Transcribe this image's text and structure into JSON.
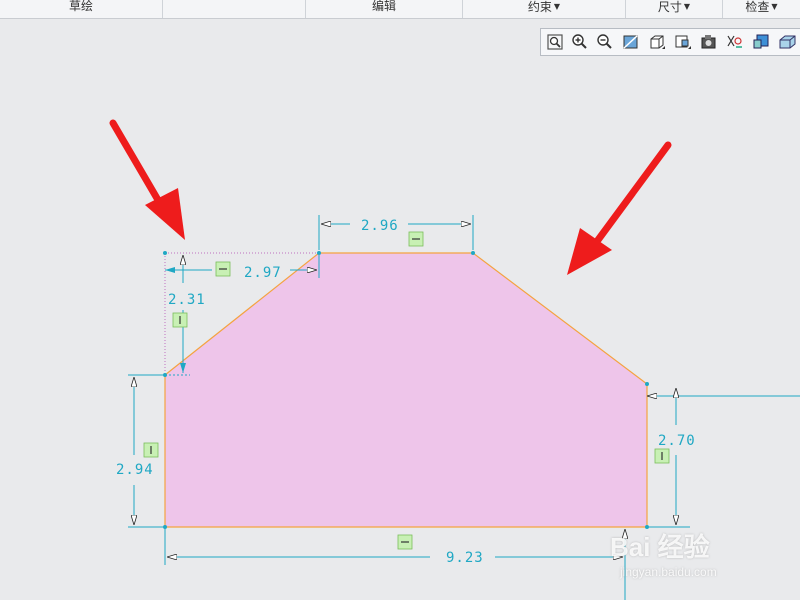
{
  "ribbon": {
    "groups": [
      {
        "label": "草绘",
        "dropdown": false
      },
      {
        "label": "编辑",
        "dropdown": false
      },
      {
        "label": "约束",
        "dropdown": true
      },
      {
        "label": "尺寸",
        "dropdown": true
      },
      {
        "label": "检查",
        "dropdown": true
      }
    ]
  },
  "view_toolbar": {
    "buttons": [
      "refit-icon",
      "zoom-in-icon",
      "zoom-out-icon",
      "repaint-icon",
      "display-style-icon",
      "saved-orientations-icon",
      "view-manager-icon",
      "sketch-display-filters-icon",
      "sketch-view-icon",
      "section-view-icon"
    ]
  },
  "sketch": {
    "fill_color": "#eec5ea",
    "edge_color": "#f4a340",
    "dimension_color": "#20a8c4",
    "dimensions": {
      "top": "2.96",
      "chamfer_left_horizontal": "2.97",
      "chamfer_left_vertical": "2.31",
      "left_height": "2.94",
      "right_height": "2.70",
      "bottom_width": "9.23"
    }
  },
  "annotations": {
    "arrow_color": "#ee1c1c",
    "count": 2
  },
  "watermark": {
    "brand": "Bai 经验",
    "url": "jingyan.baidu.com"
  }
}
